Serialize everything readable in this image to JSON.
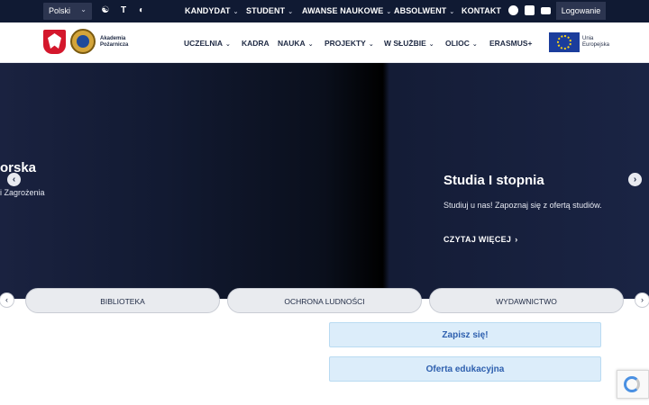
{
  "topbar": {
    "language": "Polski",
    "nav": [
      "KANDYDAT",
      "STUDENT",
      "AWANSE NAUKOWE",
      "ABSOLWENT",
      "KONTAKT"
    ],
    "login_label": "Logowanie",
    "accessibility_icons": [
      "accessibility-icon",
      "font-size-icon",
      "contrast-icon"
    ],
    "social_icons": [
      "facebook-icon",
      "linkedin-icon",
      "youtube-icon"
    ]
  },
  "header": {
    "brand_line1": "Akademia",
    "brand_line2": "Pożarnicza",
    "nav": [
      "UCZELNIA",
      "KADRA",
      "NAUKA",
      "PROJEKTY",
      "W SŁUŻBIE",
      "OLIOC",
      "ERASMUS+"
    ],
    "eu_line1": "Unia",
    "eu_line2": "Europejska"
  },
  "hero": {
    "left_title": "orska",
    "left_subtitle": "i Zagrożenia",
    "right_title": "Studia I stopnia",
    "right_subtitle": "Studiuj u nas! Zapoznaj się z ofertą studiów.",
    "read_more": "CZYTAJ WIĘCEJ"
  },
  "quick_links": [
    "BIBLIOTEKA",
    "OCHRONA LUDNOŚCI",
    "WYDAWNICTWO"
  ],
  "cta": {
    "signup": "Zapisz się!",
    "offer": "Oferta edukacyjna"
  },
  "colors": {
    "topbar_bg": "#101a33",
    "cta_bg": "#dcedfa",
    "cta_text": "#2d5fae"
  }
}
